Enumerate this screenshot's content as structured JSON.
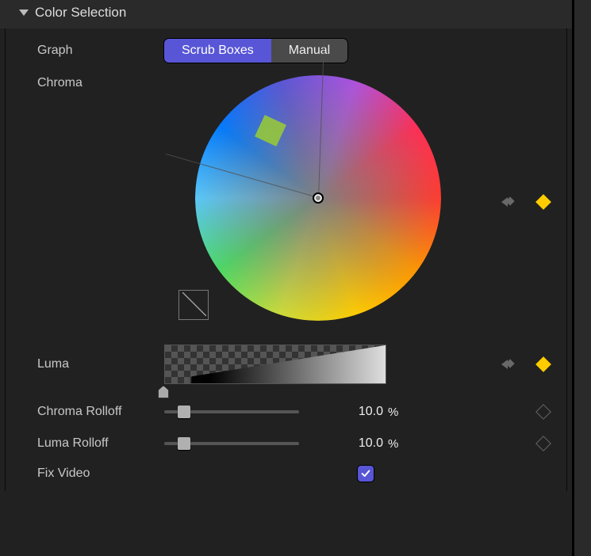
{
  "section": {
    "title": "Color Selection"
  },
  "graph": {
    "label": "Graph",
    "mode_scrub": "Scrub Boxes",
    "mode_manual": "Manual",
    "active": "scrub"
  },
  "chroma": {
    "label": "Chroma"
  },
  "luma": {
    "label": "Luma"
  },
  "chroma_rolloff": {
    "label": "Chroma Rolloff",
    "value": "10.0",
    "unit": "%",
    "slider_pct": 10
  },
  "luma_rolloff": {
    "label": "Luma Rolloff",
    "value": "10.0",
    "unit": "%",
    "slider_pct": 10
  },
  "fix_video": {
    "label": "Fix Video",
    "checked": true
  }
}
